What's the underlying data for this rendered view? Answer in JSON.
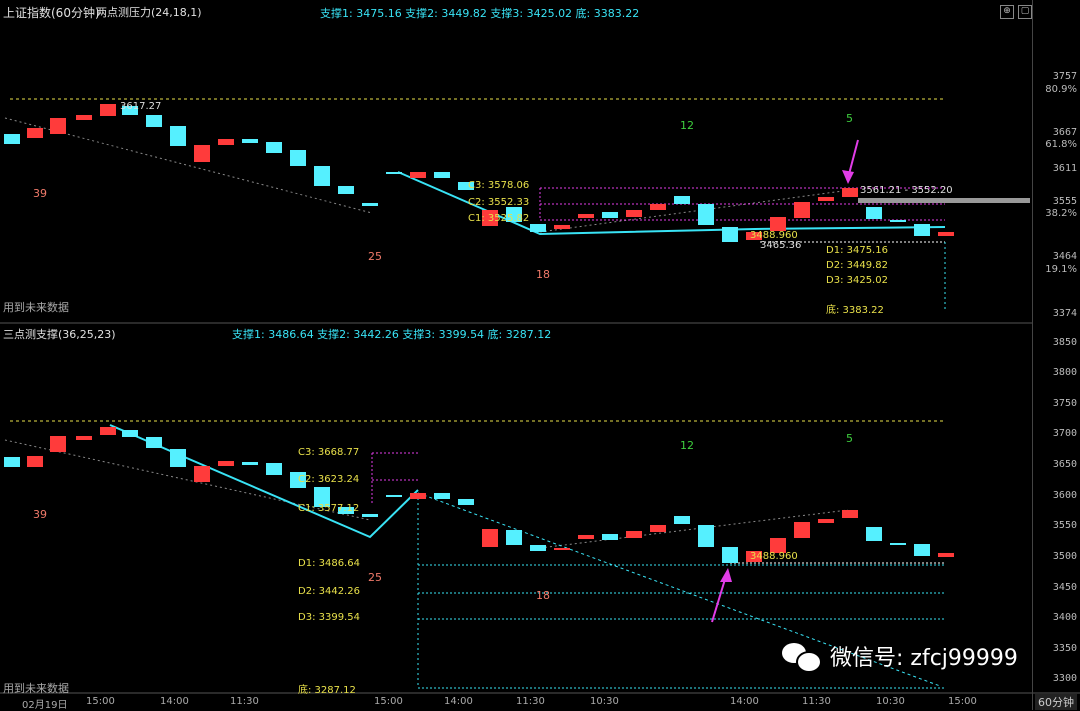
{
  "top": {
    "title": "上证指数(60分钟)",
    "indicator": "两点测压力(24,18,1)",
    "supports": "支撑1: 3475.16 支撑2: 3449.82 支撑3: 3425.02 底: 3383.22",
    "y_ticks": [
      "3757",
      "3667",
      "3611",
      "3555",
      "3464",
      "3374"
    ],
    "y_pct": [
      "80.9%",
      "61.8%",
      "38.2%",
      "19.1%"
    ],
    "labels": {
      "c3": "C3: 3578.06",
      "c2": "C2: 3552.33",
      "c1": "C1: 3525.82",
      "d1": "D1: 3475.16",
      "d2": "D2: 3449.82",
      "d3": "D3: 3425.02",
      "bottom": "底: 3383.22",
      "high": "3617.27",
      "range": "3561.21 - 3552.20",
      "p1": "3488.960",
      "p2": "3465.36"
    },
    "counts": {
      "a": "39",
      "b": "25",
      "c": "18",
      "d": "12",
      "e": "5"
    },
    "future": "用到未来数据"
  },
  "bottom": {
    "indicator": "三点测支撑(36,25,23)",
    "supports": "支撑1: 3486.64 支撑2: 3442.26 支撑3: 3399.54 底: 3287.12",
    "y_ticks": [
      "3850",
      "3800",
      "3750",
      "3700",
      "3650",
      "3600",
      "3550",
      "3500",
      "3450",
      "3400",
      "3350",
      "3300"
    ],
    "labels": {
      "c3": "C3: 3668.77",
      "c2": "C2: 3623.24",
      "c1": "C1: 3577.12",
      "d1": "D1: 3486.64",
      "d2": "D2: 3442.26",
      "d3": "D3: 3399.54",
      "bottom": "底: 3287.12",
      "p1": "3488.960"
    },
    "counts": {
      "a": "39",
      "b": "25",
      "c": "18",
      "d": "12",
      "e": "5"
    },
    "future": "用到未来数据"
  },
  "x_ticks": [
    "02月19日",
    "15:00",
    "14:00",
    "11:30",
    "15:00",
    "14:00",
    "11:30",
    "10:30",
    "14:00",
    "11:30",
    "10:30",
    "15:00"
  ],
  "period": "60分钟",
  "watermark": "微信号: zfcj99999",
  "colors": {
    "up": "#ff3b3b",
    "down": "#55f0ff",
    "support": "#39e3f5",
    "level": "#e8e04a",
    "arrow": "#e23de8"
  },
  "icons": [
    "zoom-in-icon",
    "window-icon",
    "close-icon"
  ]
}
